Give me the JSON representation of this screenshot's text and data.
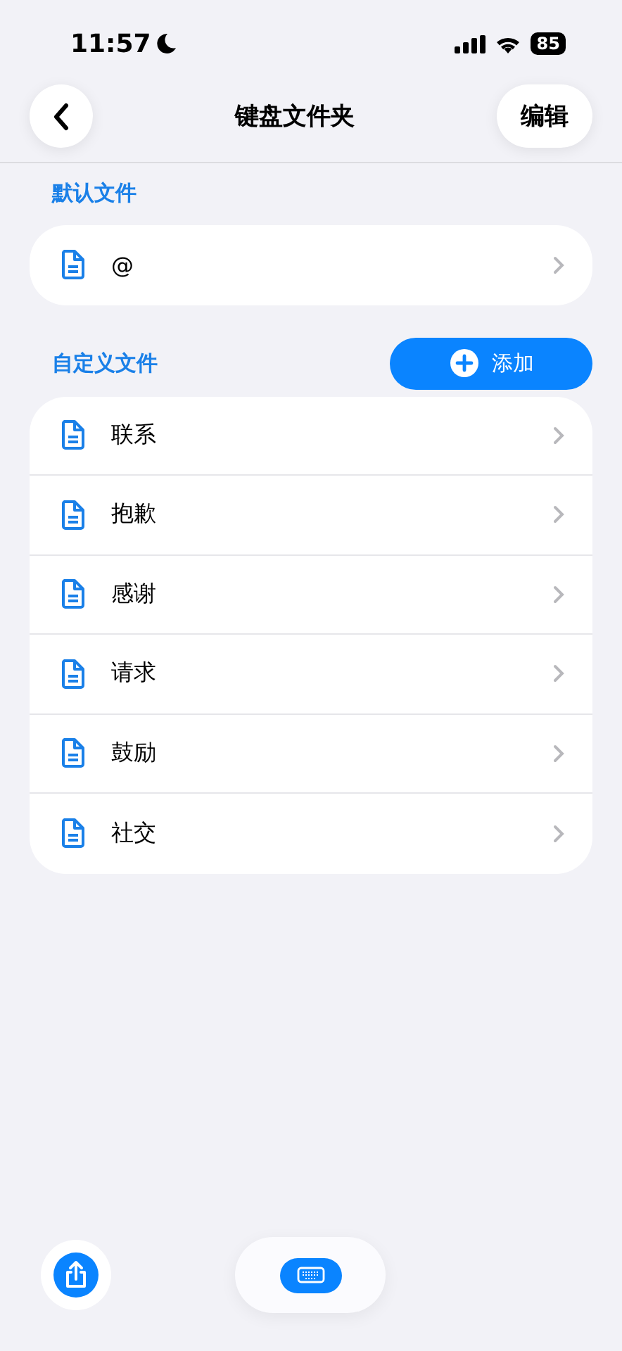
{
  "status_bar": {
    "time": "11:57",
    "battery": "85"
  },
  "nav": {
    "title": "键盘文件夹",
    "edit": "编辑"
  },
  "default_section": {
    "title": "默认文件",
    "items": [
      {
        "label": "@"
      }
    ]
  },
  "custom_section": {
    "title": "自定义文件",
    "add": "添加",
    "items": [
      {
        "label": "联系"
      },
      {
        "label": "抱歉"
      },
      {
        "label": "感谢"
      },
      {
        "label": "请求"
      },
      {
        "label": "鼓励"
      },
      {
        "label": "社交"
      }
    ]
  }
}
